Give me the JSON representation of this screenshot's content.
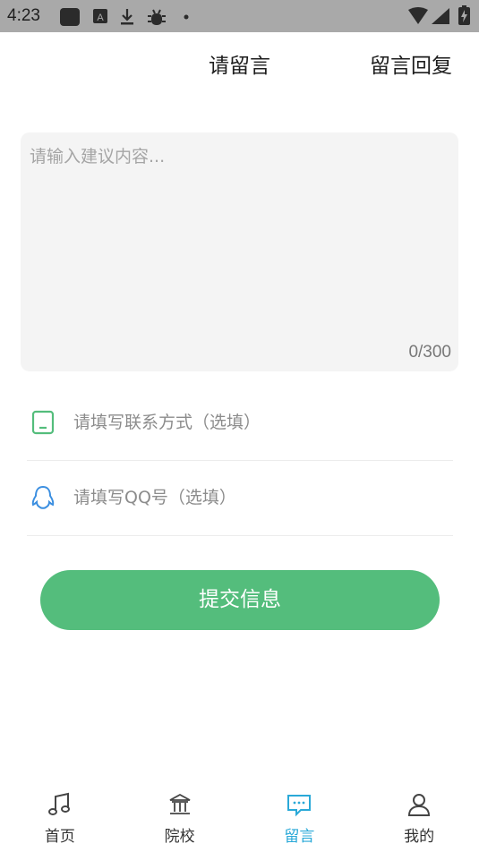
{
  "status_bar": {
    "time": "4:23"
  },
  "header": {
    "title": "请留言",
    "action_label": "留言回复"
  },
  "message": {
    "placeholder": "请输入建议内容...",
    "counter": "0/300"
  },
  "fields": {
    "contact_placeholder": "请填写联系方式（选填）",
    "qq_placeholder": "请填写QQ号（选填）"
  },
  "submit_label": "提交信息",
  "nav": {
    "items": [
      {
        "label": "首页",
        "icon": "music-note-icon"
      },
      {
        "label": "院校",
        "icon": "school-building-icon"
      },
      {
        "label": "留言",
        "icon": "chat-bubble-icon",
        "active": true
      },
      {
        "label": "我的",
        "icon": "user-icon"
      }
    ]
  },
  "colors": {
    "accent_green": "#54bd7c",
    "active_nav": "#2aa9d8",
    "status_bar": "#a9a9a9"
  }
}
